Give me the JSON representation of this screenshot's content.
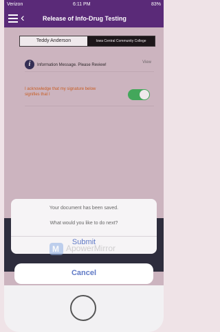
{
  "status_bar": {
    "carrier": "Verizon",
    "time": "6:11 PM",
    "battery": "83%"
  },
  "nav": {
    "title": "Release of Info-Drug Testing"
  },
  "signature": {
    "name": "Teddy Anderson",
    "school": "Iowa Central Community College"
  },
  "info": {
    "message": "Information Message. Please Review!",
    "view": "View"
  },
  "acknowledge": {
    "text": "I acknowledge that my signature below signifies that I",
    "toggle_on": true
  },
  "action_sheet": {
    "message1": "Your document has been saved.",
    "message2": "What would you like to do next?",
    "submit": "Submit",
    "cancel": "Cancel"
  },
  "watermark": "ApowerMirror",
  "colors": {
    "brand": "#5a2a78",
    "accent": "#5f79c6",
    "toggle": "#3cb45a",
    "warning": "#d2601a"
  }
}
